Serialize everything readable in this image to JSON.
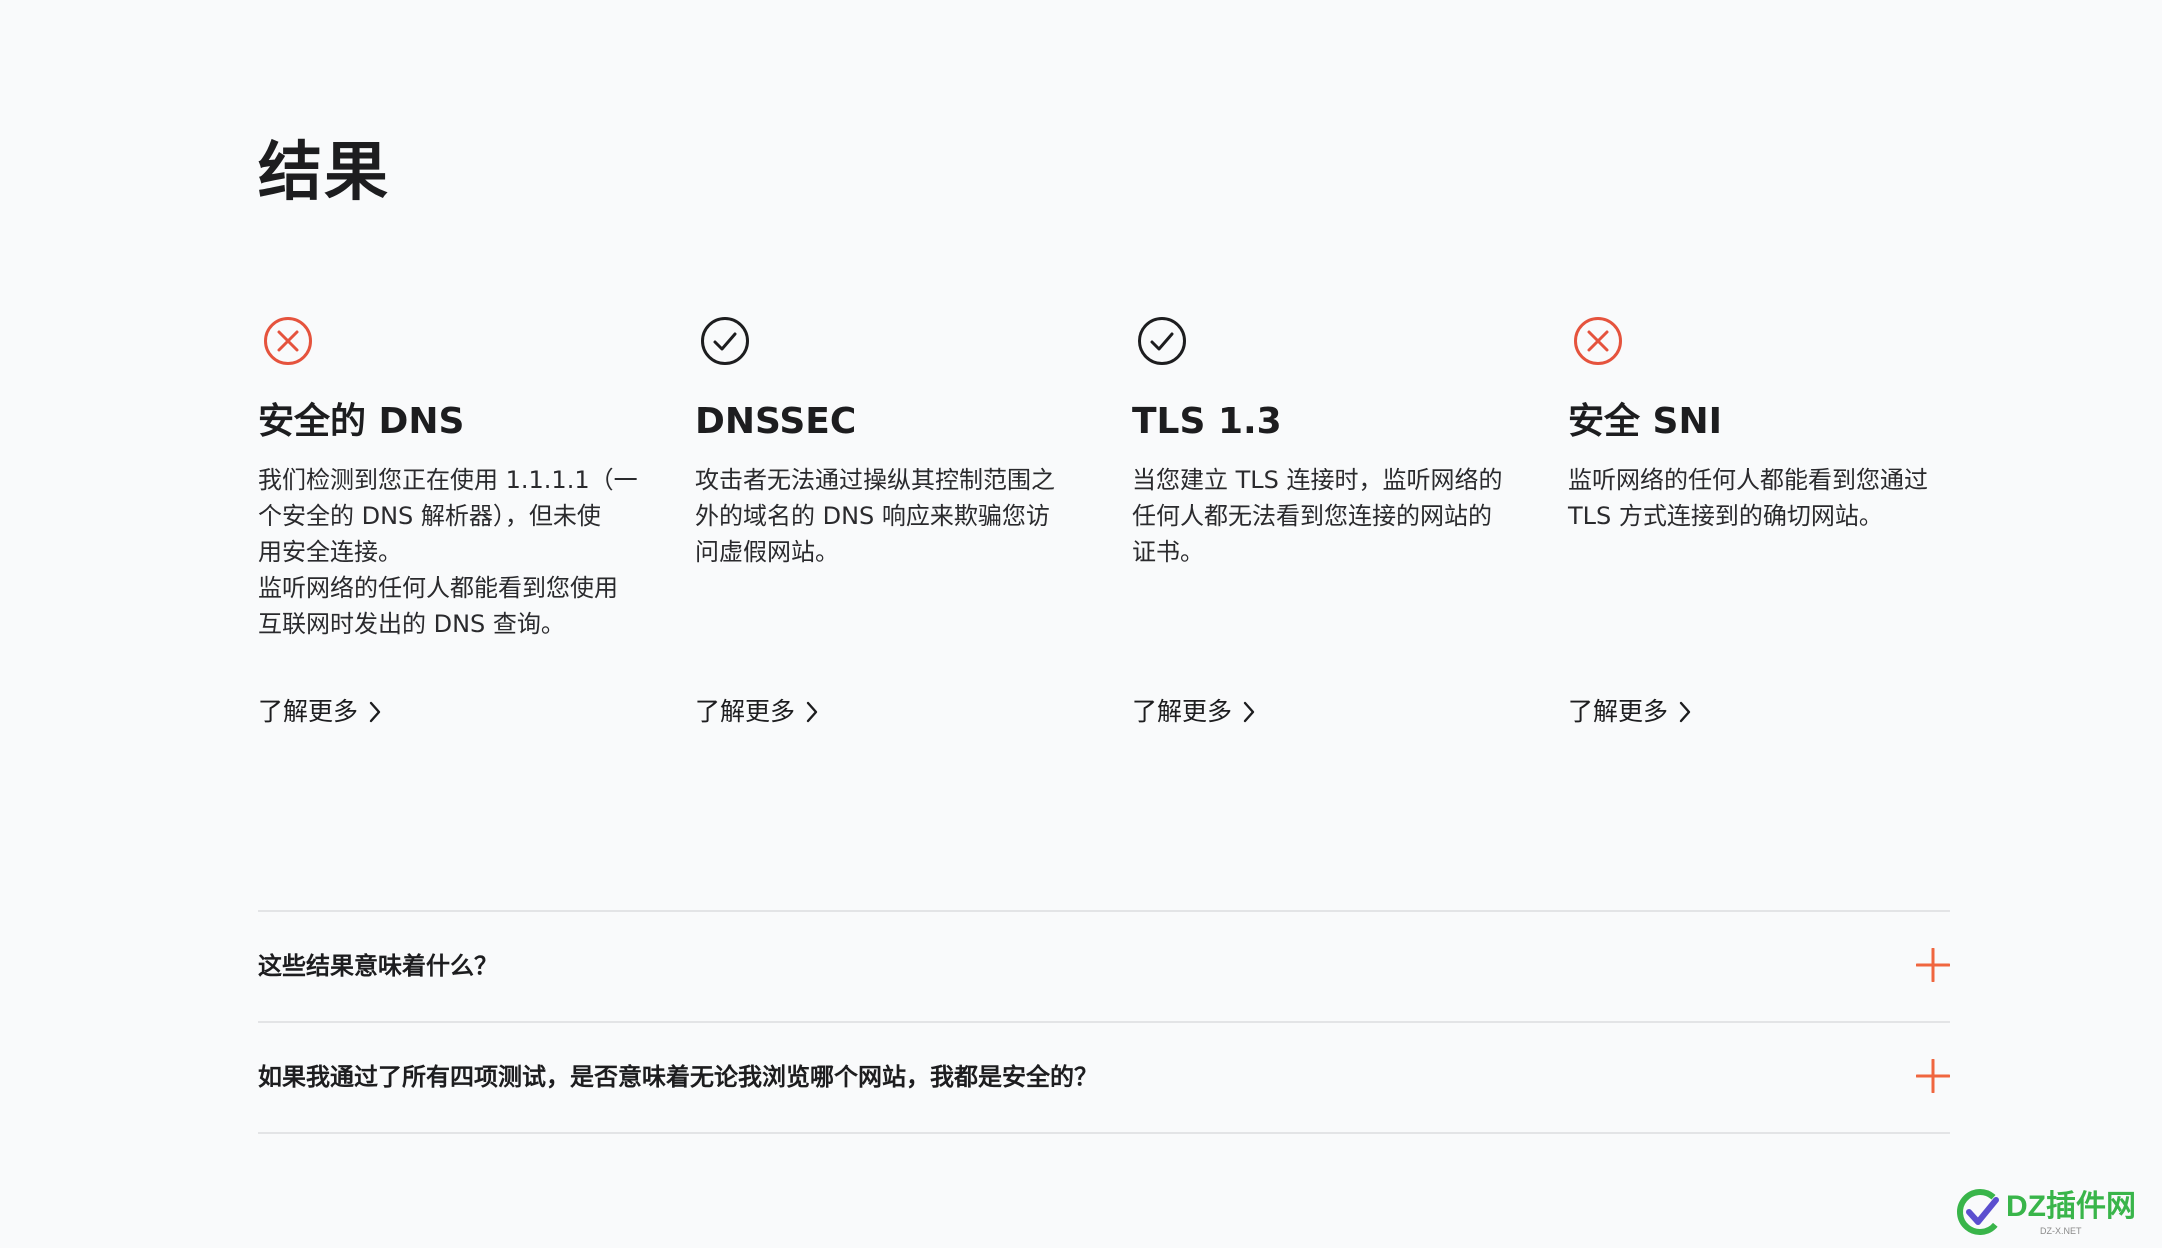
{
  "page": {
    "title": "结果"
  },
  "cards": [
    {
      "status": "fail",
      "status_icon": "x-circle-icon",
      "title": "安全的 DNS",
      "description": "我们检测到您正在使用 1.1.1.1（一\n个安全的 DNS 解析器），但未使\n用安全连接。\n监听网络的任何人都能看到您使用\n互联网时发出的 DNS 查询。",
      "link_label": "了解更多"
    },
    {
      "status": "pass",
      "status_icon": "check-circle-icon",
      "title": "DNSSEC",
      "description": "攻击者无法通过操纵其控制范围之\n外的域名的 DNS 响应来欺骗您访\n问虚假网站。",
      "link_label": "了解更多"
    },
    {
      "status": "pass",
      "status_icon": "check-circle-icon",
      "title": "TLS 1.3",
      "description": "当您建立 TLS 连接时，监听网络的\n任何人都无法看到您连接的网站的\n证书。",
      "link_label": "了解更多"
    },
    {
      "status": "fail",
      "status_icon": "x-circle-icon",
      "title": "安全 SNI",
      "description": "监听网络的任何人都能看到您通过\nTLS 方式连接到的确切网站。",
      "link_label": "了解更多"
    }
  ],
  "faq": [
    {
      "question": "这些结果意味着什么？",
      "icon": "plus-icon"
    },
    {
      "question": "如果我通过了所有四项测试，是否意味着无论我浏览哪个网站，我都是安全的？",
      "icon": "plus-icon"
    }
  ],
  "watermark": {
    "text": "DZ插件网",
    "subtext": "DZ-X.NET"
  },
  "colors": {
    "fail": "#e5533d",
    "pass": "#1d1d1f",
    "accent": "#f0663f",
    "background": "#f9fafb",
    "divider": "#e3e4e6",
    "watermark_green": "#39b54a",
    "watermark_purple": "#5b4fcf"
  }
}
